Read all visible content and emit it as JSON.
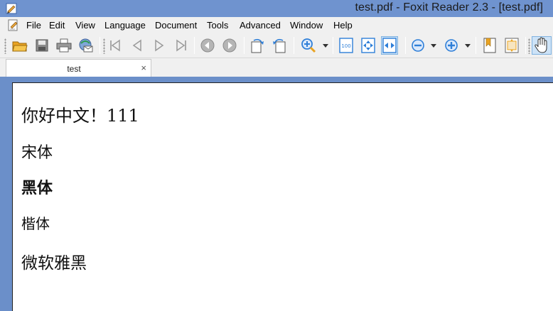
{
  "window": {
    "title": "test.pdf - Foxit Reader 2.3 - [test.pdf]"
  },
  "menu": [
    {
      "label": "File"
    },
    {
      "label": "Edit"
    },
    {
      "label": "View"
    },
    {
      "label": "Language"
    },
    {
      "label": "Document"
    },
    {
      "label": "Tools"
    },
    {
      "label": "Advanced"
    },
    {
      "label": "Window"
    },
    {
      "label": "Help"
    }
  ],
  "toolbar": {
    "buttons": [
      "open-folder-icon",
      "save-icon",
      "print-icon",
      "email-icon",
      "first-page-icon",
      "previous-page-icon",
      "next-page-icon",
      "last-page-icon",
      "go-back-icon",
      "go-forward-icon",
      "rotate-left-icon",
      "rotate-right-icon",
      "zoom-in-tool-icon",
      "actual-size-icon",
      "fit-page-icon",
      "fit-width-icon",
      "zoom-out-icon",
      "zoom-in-icon",
      "bookmark-icon",
      "fit-visible-icon",
      "hand-tool-icon"
    ],
    "colors": {
      "accent": "#2f7fd8",
      "active_bg": "#cde3f7",
      "folder": "#f2b531",
      "green": "#2e9b4e"
    }
  },
  "tabs": [
    {
      "label": "test",
      "close": "×"
    }
  ],
  "document": {
    "lines": [
      {
        "text": "你好中文！111"
      },
      {
        "text": "宋体"
      },
      {
        "text": "黑体"
      },
      {
        "text": "楷体"
      },
      {
        "text": "微软雅黑"
      }
    ]
  },
  "colors": {
    "titlebar": "#6f93cf",
    "workspace": "#6b8fc9",
    "chrome": "#f0f0f0"
  }
}
